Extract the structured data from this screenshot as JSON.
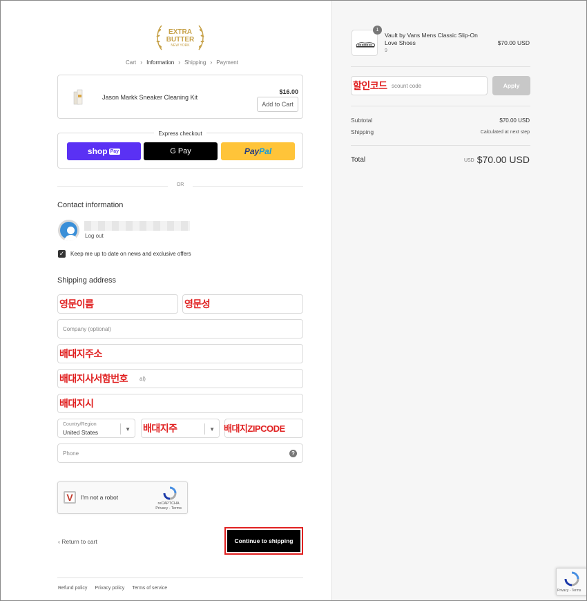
{
  "brand": {
    "line1": "EXTRA",
    "line2": "BUTTER",
    "line3": "NEW YORK",
    "color": "#c7a24a"
  },
  "breadcrumb": {
    "items": [
      "Cart",
      "Information",
      "Shipping",
      "Payment"
    ]
  },
  "upsell": {
    "name": "Jason Markk Sneaker Cleaning Kit",
    "price": "$16.00",
    "add_label": "Add to Cart"
  },
  "express": {
    "title": "Express checkout",
    "shop_label": "shop",
    "shop_tag": "Pay",
    "gpay_label": "G Pay",
    "paypal_label_1": "Pay",
    "paypal_label_2": "Pal"
  },
  "or_label": "OR",
  "contact": {
    "title": "Contact information",
    "logout": "Log out",
    "newsletter": "Keep me up to date on news and exclusive offers",
    "checkmark": "✓"
  },
  "shipping": {
    "title": "Shipping address",
    "first_name_annot": "영문이름",
    "last_name_annot": "영문성",
    "company_placeholder": "Company (optional)",
    "address_annot": "배대지주소",
    "apt_annot": "배대지사서함번호",
    "apt_fragment": "al)",
    "city_annot": "배대지시",
    "country_label": "Country/Region",
    "country_value": "United States",
    "state_annot": "배대지주",
    "zip_annot": "배대지ZIPCODE",
    "phone_placeholder": "Phone",
    "help": "?"
  },
  "recaptcha": {
    "text": "I'm not a robot",
    "brand": "reCAPTCHA",
    "links": "Privacy - Terms",
    "badge_links": "Privacy - Terms"
  },
  "actions": {
    "return": "Return to cart",
    "continue": "Continue to shipping"
  },
  "footer": {
    "links": [
      "Refund policy",
      "Privacy policy",
      "Terms of service"
    ]
  },
  "order": {
    "product_name": "Vault by Vans Mens Classic Slip-On Love Shoes",
    "variant": "9",
    "qty": "1",
    "price": "$70.00 USD",
    "discount_annot": "할인코드",
    "discount_placeholder": "scount code",
    "apply": "Apply",
    "subtotal_label": "Subtotal",
    "subtotal_value": "$70.00 USD",
    "shipping_label": "Shipping",
    "shipping_value": "Calculated at next step",
    "total_label": "Total",
    "total_currency": "USD",
    "total_value": "$70.00 USD"
  },
  "colors": {
    "accent_red": "#e02020",
    "shop_pay": "#5a31f4",
    "paypal": "#ffc439"
  }
}
